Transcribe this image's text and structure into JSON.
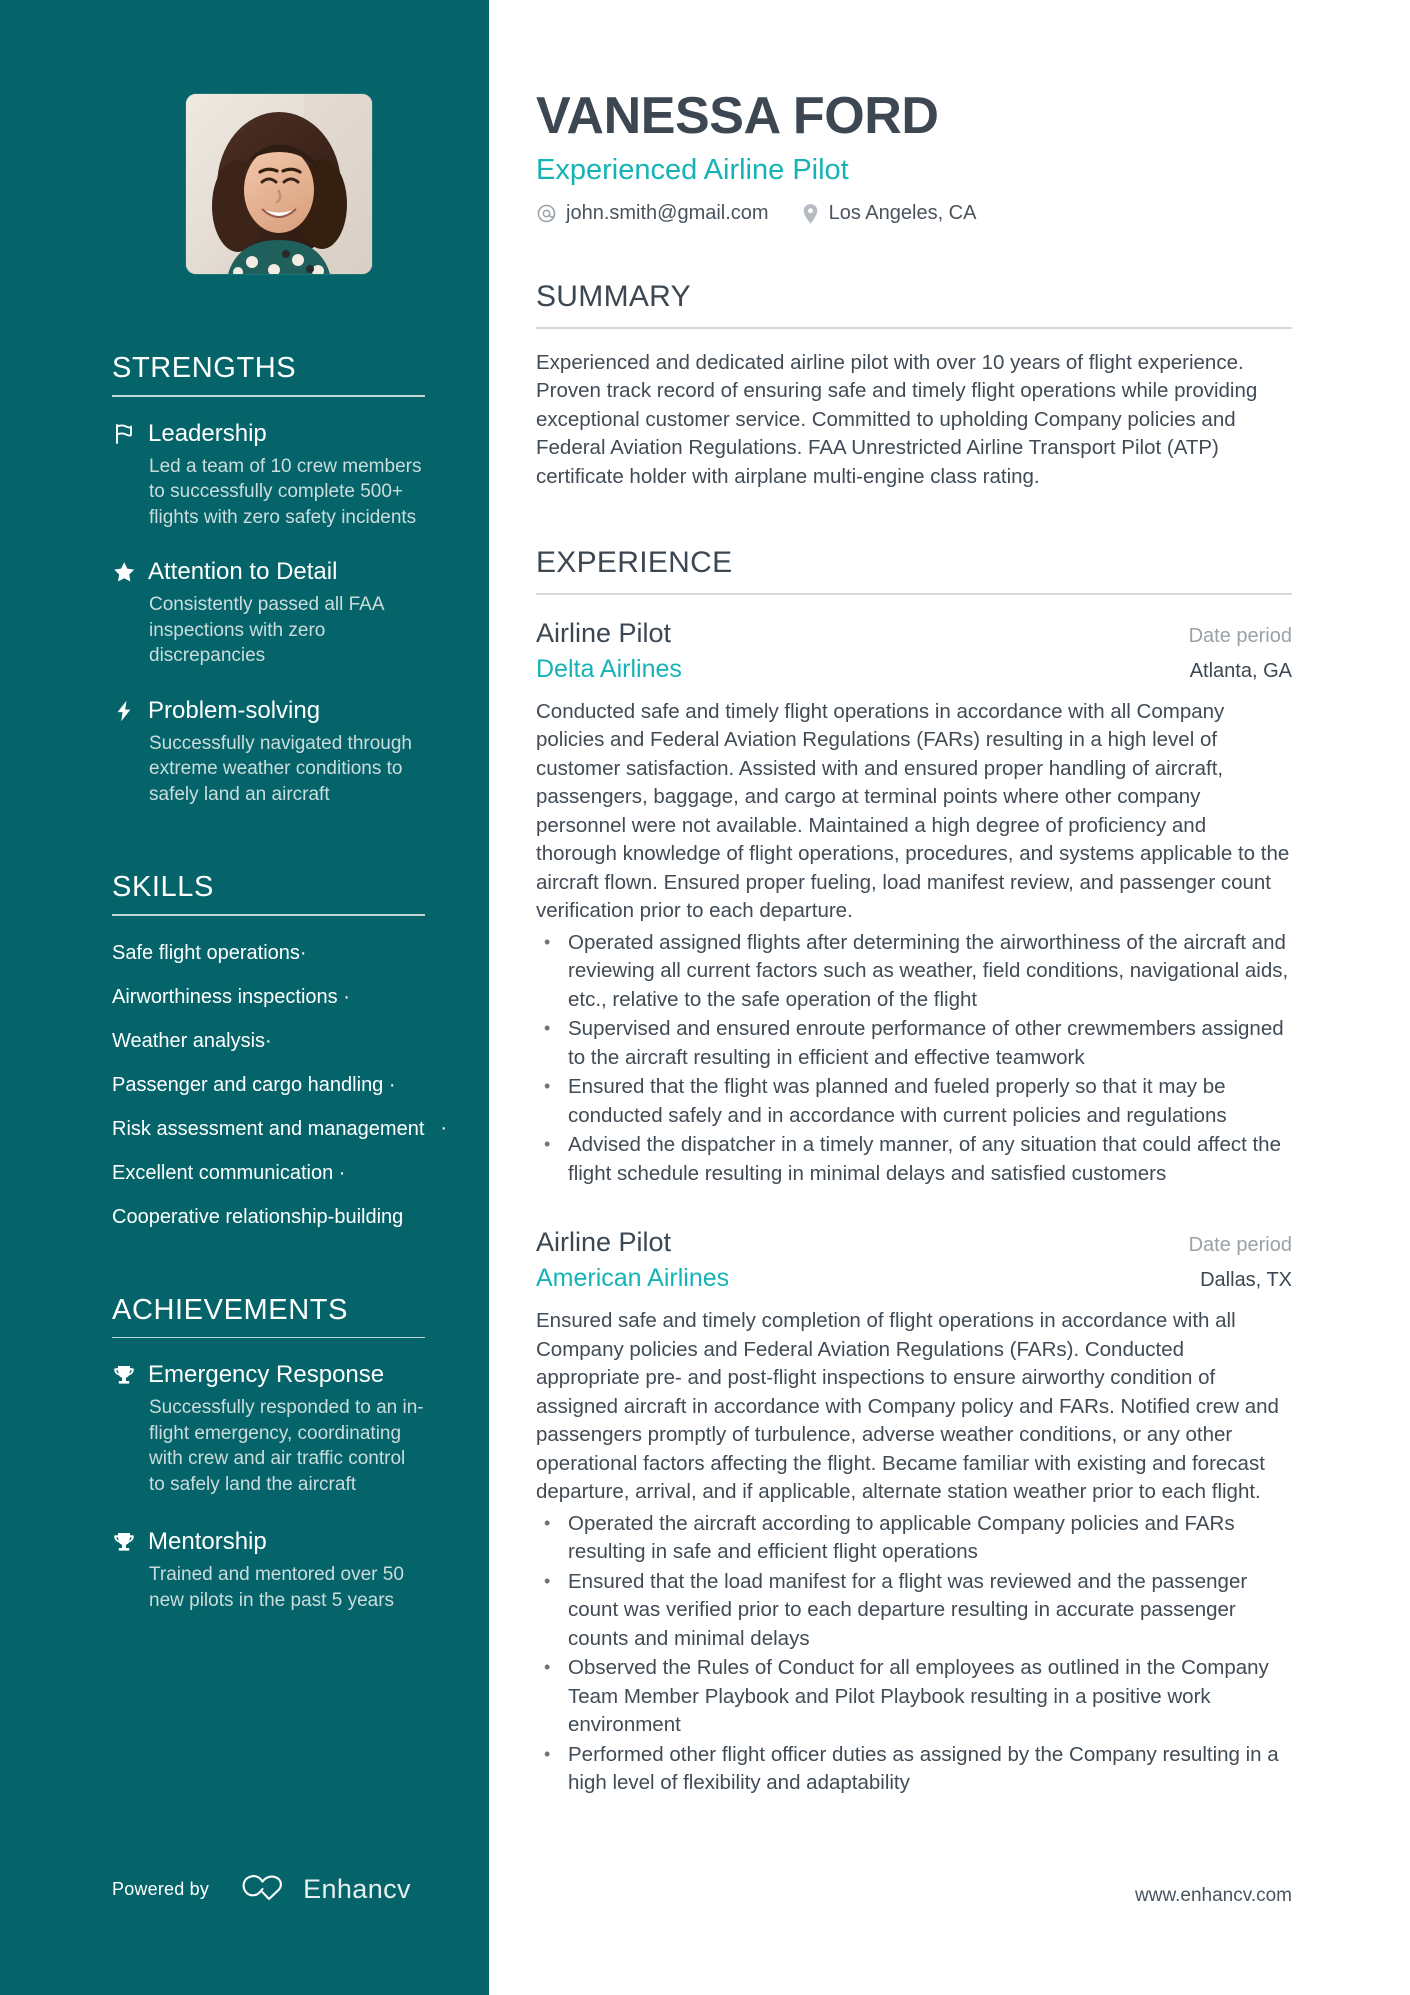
{
  "theme": {
    "sidebar_bg": "#05646a",
    "accent_teal": "#15b3b6",
    "heading_dark": "#3c4752",
    "body_text": "#414b55",
    "muted": "#9aa2a9",
    "sidebar_desc": "#cbdcdc"
  },
  "header": {
    "name": "VANESSA FORD",
    "role": "Experienced Airline Pilot",
    "email": "john.smith@gmail.com",
    "location": "Los Angeles, CA",
    "email_icon": "at-sign-icon",
    "location_icon": "map-pin-icon",
    "photo_alt": "profile-photo"
  },
  "sidebar": {
    "strengths": {
      "heading": "STRENGTHS",
      "items": [
        {
          "icon": "flag-icon",
          "title": "Leadership",
          "description": "Led a team of 10 crew members to successfully complete 500+ flights with zero safety incidents"
        },
        {
          "icon": "star-icon",
          "title": "Attention to Detail",
          "description": "Consistently passed all FAA inspections with zero discrepancies"
        },
        {
          "icon": "lightning-bolt-icon",
          "title": "Problem-solving",
          "description": "Successfully navigated through extreme weather conditions to safely land an aircraft"
        }
      ]
    },
    "skills": {
      "heading": "SKILLS",
      "separator": "·",
      "items": [
        "Safe flight operations",
        "Airworthiness inspections",
        "Weather analysis",
        "Passenger and cargo handling",
        "Risk assessment and management",
        "Excellent communication",
        "Cooperative relationship-building"
      ]
    },
    "achievements": {
      "heading": "ACHIEVEMENTS",
      "items": [
        {
          "icon": "trophy-icon",
          "title": "Emergency Response",
          "description": "Successfully responded to an in-flight emergency, coordinating with crew and air traffic control to safely land the aircraft"
        },
        {
          "icon": "trophy-icon",
          "title": "Mentorship",
          "description": "Trained and mentored over 50 new pilots in the past 5 years"
        }
      ]
    },
    "footer": {
      "powered_by": "Powered by",
      "brand": "Enhancv",
      "brand_icon": "enhancv-infinity-logo"
    }
  },
  "main": {
    "summary": {
      "heading": "SUMMARY",
      "text": "Experienced and dedicated airline pilot with over 10 years of flight experience. Proven track record of ensuring safe and timely flight operations while providing exceptional customer service. Committed to upholding Company policies and Federal Aviation Regulations. FAA Unrestricted Airline Transport Pilot (ATP) certificate holder with airplane multi-engine class rating."
    },
    "experience": {
      "heading": "EXPERIENCE",
      "jobs": [
        {
          "title": "Airline Pilot",
          "dates": "Date period",
          "company": "Delta Airlines",
          "location": "Atlanta, GA",
          "description": "Conducted safe and timely flight operations in accordance with all Company policies and Federal Aviation Regulations (FARs) resulting in a high level of customer satisfaction. Assisted with and ensured proper handling of aircraft, passengers, baggage, and cargo at terminal points where other company personnel were not available. Maintained a high degree of proficiency and thorough knowledge of flight operations, procedures, and systems applicable to the aircraft flown. Ensured proper fueling, load manifest review, and passenger count verification prior to each departure.",
          "bullets": [
            "Operated assigned flights after determining the airworthiness of the aircraft and reviewing all current factors such as weather, field conditions, navigational aids, etc., relative to the safe operation of the flight",
            "Supervised and ensured enroute performance of other crewmembers assigned to the aircraft resulting in efficient and effective teamwork",
            "Ensured that the flight was planned and fueled properly so that it may be conducted safely and in accordance with current policies and regulations",
            "Advised the dispatcher in a timely manner, of any situation that could affect the flight schedule resulting in minimal delays and satisfied customers"
          ]
        },
        {
          "title": "Airline Pilot",
          "dates": "Date period",
          "company": "American Airlines",
          "location": "Dallas, TX",
          "description": "Ensured safe and timely completion of flight operations in accordance with all Company policies and Federal Aviation Regulations (FARs). Conducted appropriate pre- and post-flight inspections to ensure airworthy condition of assigned aircraft in accordance with Company policy and FARs. Notified crew and passengers promptly of turbulence, adverse weather conditions, or any other operational factors affecting the flight. Became familiar with existing and forecast departure, arrival, and if applicable, alternate station weather prior to each flight.",
          "bullets": [
            "Operated the aircraft according to applicable Company policies and FARs resulting in safe and efficient flight operations",
            "Ensured that the load manifest for a flight was reviewed and the passenger count was verified prior to each departure resulting in accurate passenger counts and minimal delays",
            "Observed the Rules of Conduct for all employees as outlined in the Company Team Member Playbook and Pilot Playbook resulting in a positive work environment",
            "Performed other flight officer duties as assigned by the Company resulting in a high level of flexibility and adaptability"
          ]
        }
      ]
    },
    "footer_url": "www.enhancv.com"
  }
}
